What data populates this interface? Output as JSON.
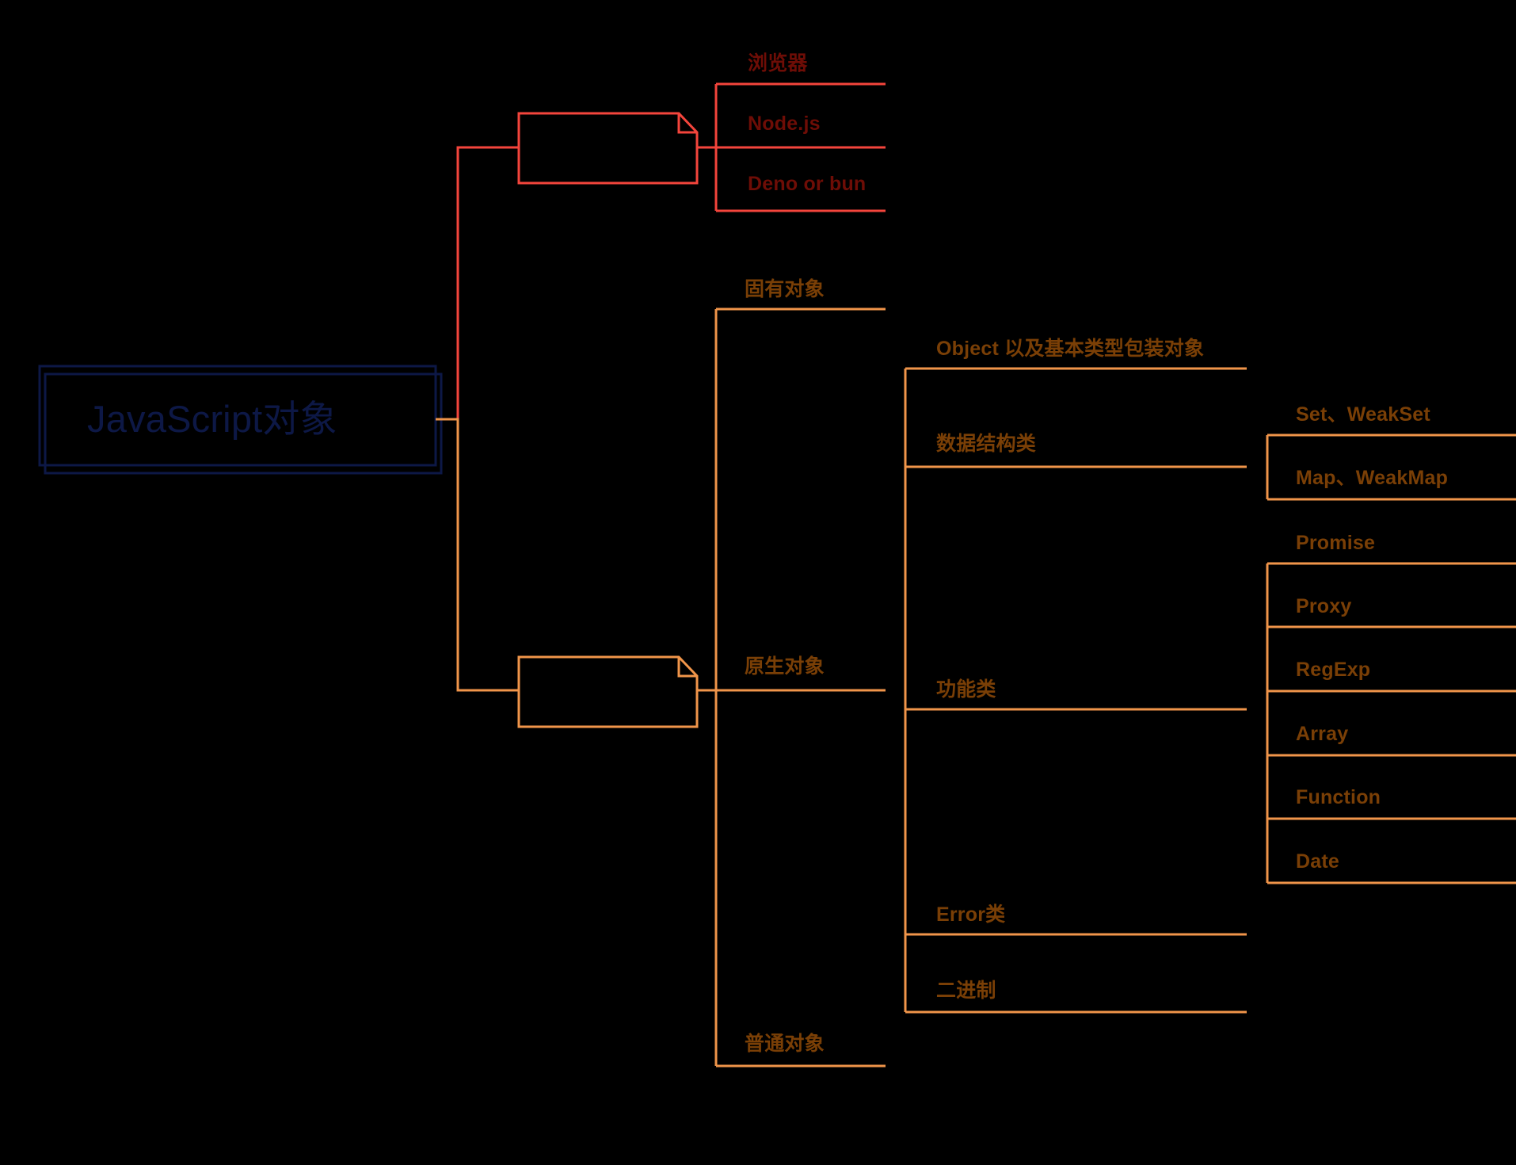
{
  "diagram": {
    "type": "mindmap",
    "title": "JavaScript对象",
    "background_color": "#000000",
    "colors": {
      "root_text": "#0D1846",
      "root_border": "#0D1846",
      "red_line": "#F4453C",
      "red_text": "#6E0D06",
      "orange_line": "#F0954A",
      "orange_text": "#7A3F06"
    }
  },
  "root": {
    "label": "JavaScript对象"
  },
  "branches": {
    "host": {
      "color_line": "#F4453C",
      "color_text": "#6E0D06",
      "note_label": "",
      "children": [
        {
          "label": "浏览器"
        },
        {
          "label": "Node.js"
        },
        {
          "label": "Deno or bun"
        }
      ]
    },
    "native": {
      "color_line": "#F0954A",
      "color_text": "#7A3F06",
      "note_label": "",
      "children": [
        {
          "label": "固有对象"
        },
        {
          "label": "原生对象",
          "children": [
            {
              "label": "Object 以及基本类型包装对象"
            },
            {
              "label": "数据结构类",
              "children": [
                {
                  "label": "Set、WeakSet"
                },
                {
                  "label": "Map、WeakMap"
                }
              ]
            },
            {
              "label": "功能类",
              "children": [
                {
                  "label": "Promise"
                },
                {
                  "label": "Proxy"
                },
                {
                  "label": "RegExp"
                },
                {
                  "label": "Array"
                },
                {
                  "label": "Function"
                },
                {
                  "label": "Date"
                }
              ]
            },
            {
              "label": "Error类"
            },
            {
              "label": "二进制"
            }
          ]
        },
        {
          "label": "普通对象"
        }
      ]
    }
  },
  "labels": {
    "root": "JavaScript对象",
    "browser": "浏览器",
    "nodejs": "Node.js",
    "deno": "Deno or bun",
    "intrinsic": "固有对象",
    "native": "原生对象",
    "ordinary": "普通对象",
    "object_wrapper": "Object 以及基本类型包装对象",
    "data_structure": "数据结构类",
    "set_weakset": "Set、WeakSet",
    "map_weakmap": "Map、WeakMap",
    "functional": "功能类",
    "promise": "Promise",
    "proxy": "Proxy",
    "regexp": "RegExp",
    "array": "Array",
    "function": "Function",
    "date": "Date",
    "error": "Error类",
    "binary": "二进制"
  }
}
